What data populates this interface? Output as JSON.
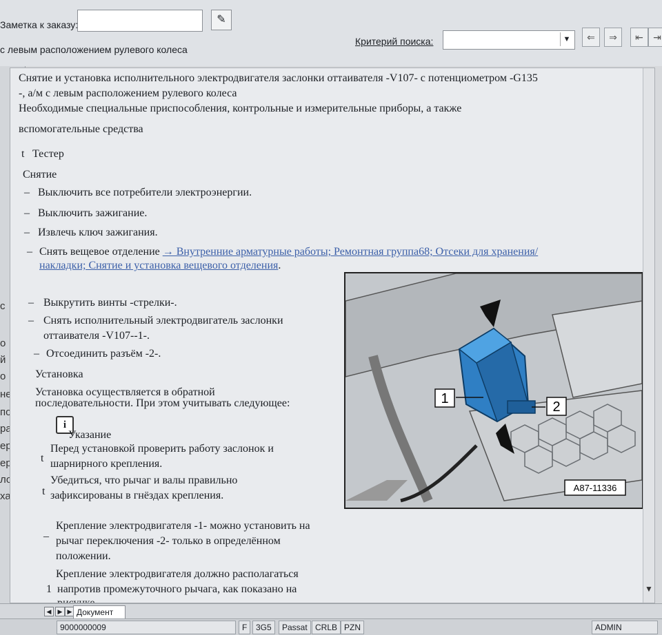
{
  "toolbar": {
    "note_label": "Заметка к заказу:",
    "subtitle": "с левым расположением рулевого колеса",
    "search_label": "Критерий поиска:",
    "search_value": "",
    "buttons": [
      "search-prev-icon",
      "search-next-icon",
      "nav-first-icon",
      "nav-last-icon"
    ]
  },
  "left_strip": [
    "с",
    "о",
    "й",
    "о",
    "не",
    "по",
    "ра",
    "ер",
    "ер",
    "ло",
    "ха"
  ],
  "document": {
    "title_line1": "Снятие и установка исполнительного электродвигателя заслонки оттаивателя -V107- с потенциометром -G135",
    "title_line2": "-, а/м с левым расположением рулевого колеса",
    "tools_line1": "Необходимые специальные приспособления, контрольные и измерительные приборы, а также",
    "tools_line2": "вспомогательные средства",
    "tool_bullet": "t",
    "tool_item": "Тестер",
    "removal_heading": "Снятие",
    "dash": "–",
    "step1": "Выключить все потребители электроэнергии.",
    "step2": "Выключить зажигание.",
    "step3": "Извлечь ключ зажигания.",
    "step4_text": "Снять вещевое отделение",
    "step4_link1": "→ Внутренние арматурные работы; Ремонтная группа68; Отсеки для хранения/",
    "step4_link2": "накладки; Снятие и установка вещевого отделения",
    "step4_end": ".",
    "step5": "Выкрутить винты -стрелки-.",
    "step6_line1": "Снять исполнительный электродвигатель заслонки",
    "step6_line2": "оттаивателя -V107--1-.",
    "step7": "Отсоединить разъём -2-.",
    "install_heading": "Установка",
    "install_line1": "Установка осуществляется в обратной",
    "install_line2": "последовательности. При этом учитывать следующее:",
    "note_icon": "i",
    "note_heading": "Указание",
    "note1_line1": "Перед установкой проверить работу заслонок и",
    "note1_line2": "шарнирного крепления.",
    "note2_line1": "Убедиться, что рычаг и валы правильно",
    "note2_line2": "зафиксированы в гнёздах крепления.",
    "para1_line1": "Крепление электродвигателя -1- можно установить на",
    "para1_line2": "рычаг переключения -2- только в определённом",
    "para1_line3": "положении.",
    "para2_line1": "Крепление электродвигателя должно располагаться",
    "para2_marker": "1",
    "para2_line2": "напротив промежуточного рычага, как показано на",
    "para2_line3": "рисунке."
  },
  "figure": {
    "label1": "1",
    "label2": "2",
    "code": "A87-11336"
  },
  "tabs": {
    "doc_tab": "Документ"
  },
  "status": {
    "order_no": "9000000009",
    "f": "F",
    "code1": "3G5",
    "model": "Passat",
    "engine": "CRLB",
    "pzn": "PZN",
    "user": "ADMIN"
  },
  "colors": {
    "link": "#3b5fa8",
    "doc_bg": "#e9ebee",
    "motor": "#2f7fc4"
  }
}
